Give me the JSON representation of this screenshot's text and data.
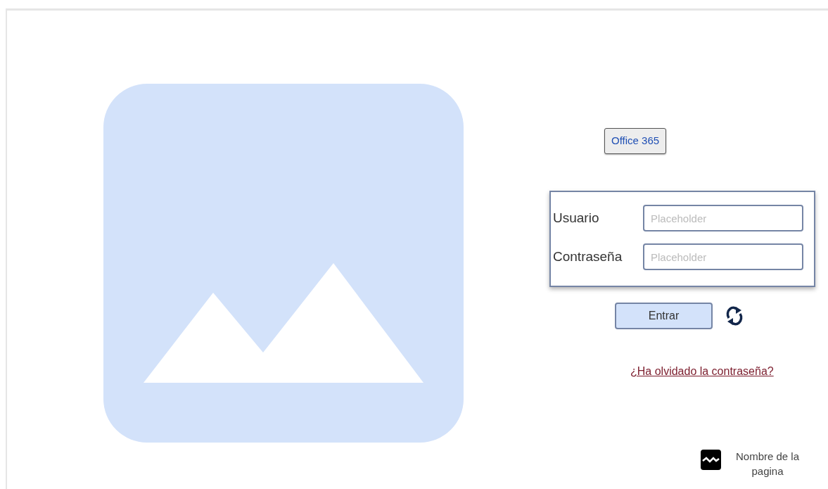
{
  "office_button": {
    "label": "Office 365"
  },
  "login": {
    "fields": [
      {
        "label": "Usuario",
        "placeholder": "Placeholder"
      },
      {
        "label": "Contraseña",
        "placeholder": "Placeholder"
      }
    ]
  },
  "submit": {
    "label": "Entrar"
  },
  "forgot_link": {
    "label": "¿Ha olvidado la contraseña?"
  },
  "footer": {
    "page_name": "Nombre de la pagina"
  }
}
